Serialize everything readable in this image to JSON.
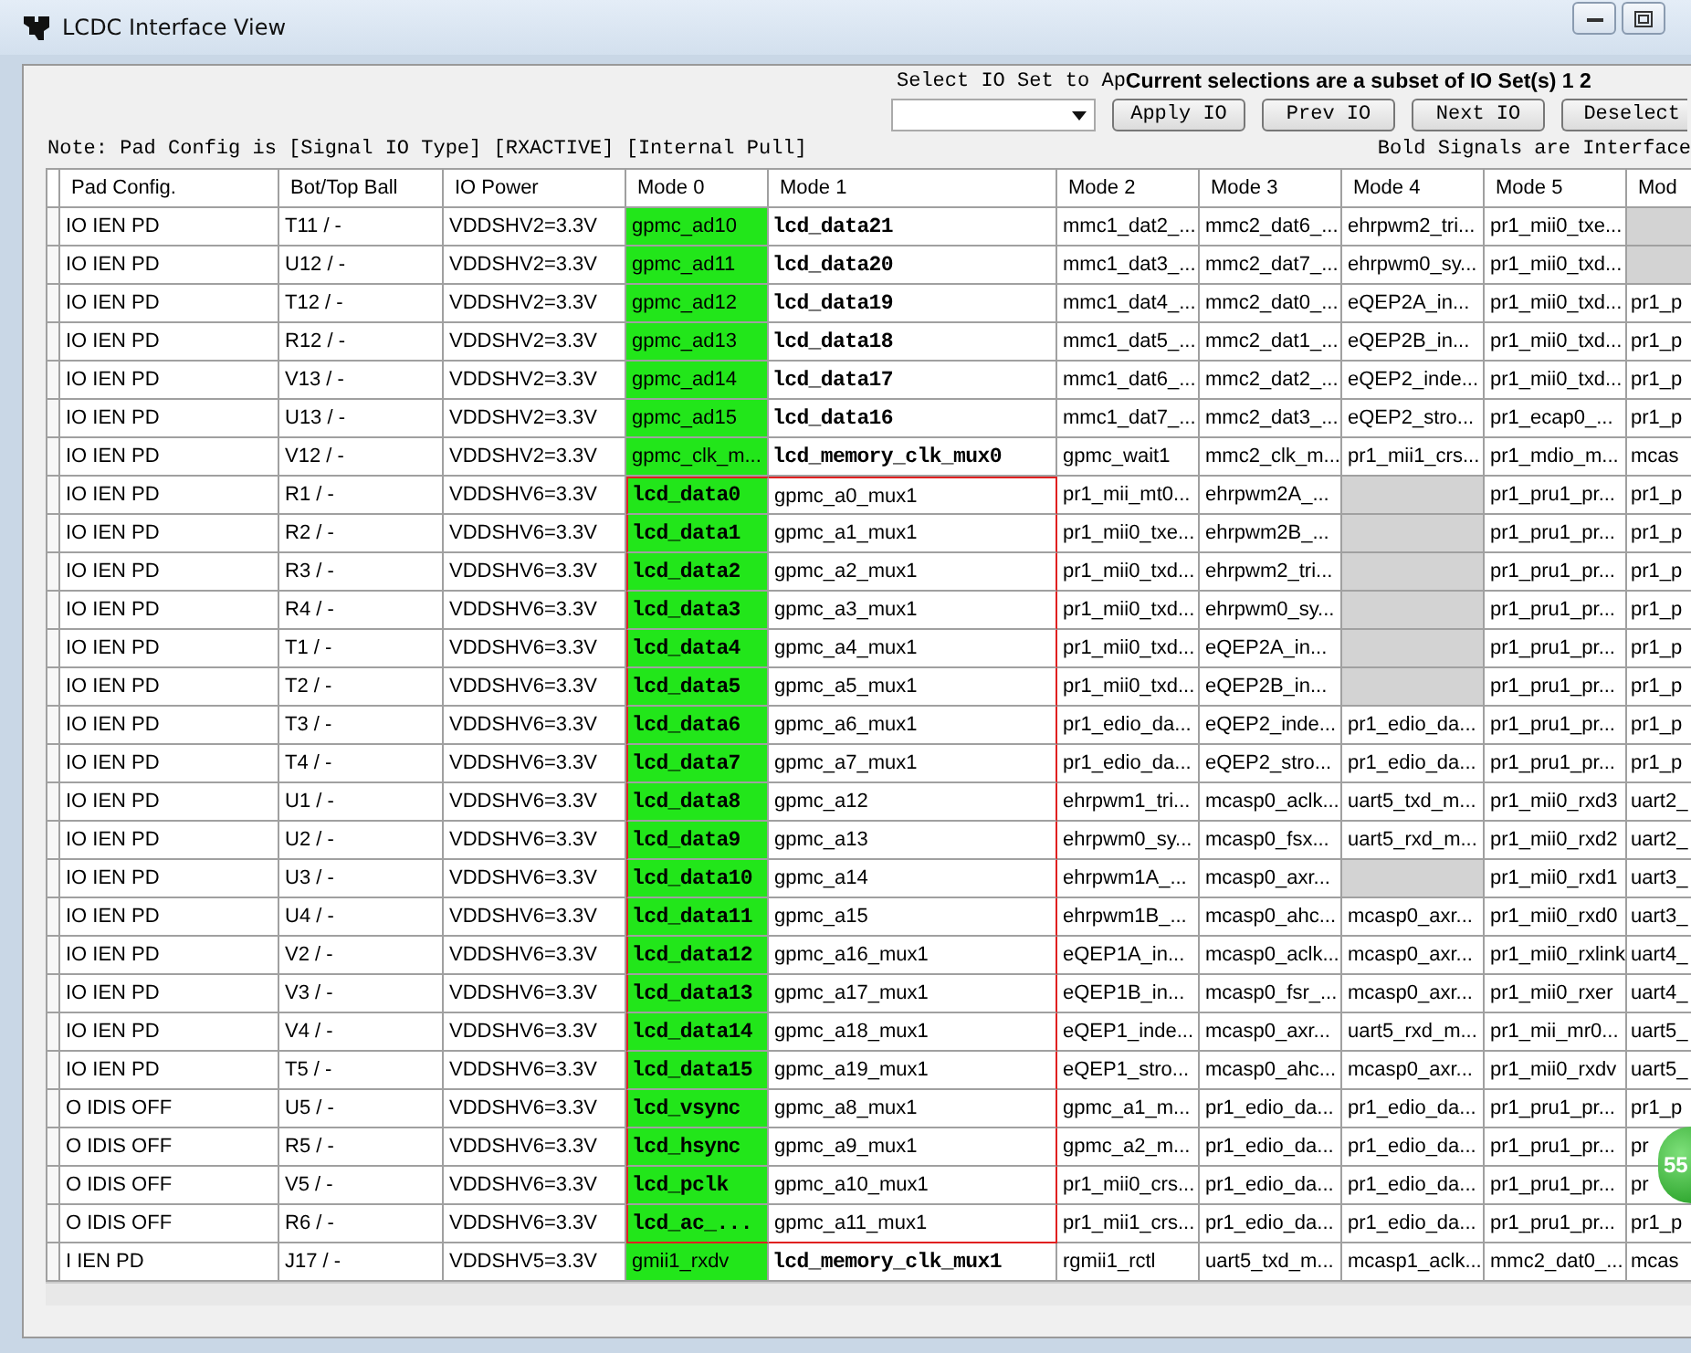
{
  "window": {
    "title": "LCDC Interface View"
  },
  "io_set": {
    "label": "Select IO Set to Ap",
    "status": "Current selections are a subset of IO Set(s)  1 2",
    "buttons": [
      "Apply IO",
      "Prev IO",
      "Next IO",
      "Deselect"
    ]
  },
  "note": "Note: Pad Config is [Signal IO Type] [RXACTIVE] [Internal Pull]",
  "legend": "Bold Signals are Interface",
  "table": {
    "columns": [
      "Pad Config.",
      "Bot/Top Ball",
      "IO Power",
      "Mode 0",
      "Mode 1",
      "Mode 2",
      "Mode 3",
      "Mode 4",
      "Mode 5",
      "Mod"
    ],
    "rows": [
      {
        "pad": "IO IEN PD",
        "ball": "T11 / -",
        "power": "VDDSHV2=3.3V",
        "outlined": false,
        "mode0": {
          "text": "gpmc_ad10",
          "bold": false,
          "selected": true
        },
        "mode1": {
          "text": "lcd_data21",
          "bold": true
        },
        "other_modes": [
          {
            "available": true,
            "text": "mmc1_dat2_..."
          },
          {
            "available": true,
            "text": "mmc2_dat6_..."
          },
          {
            "available": true,
            "text": "ehrpwm2_tri..."
          },
          {
            "available": true,
            "text": "pr1_mii0_txe..."
          },
          {
            "available": false
          }
        ]
      },
      {
        "pad": "IO IEN PD",
        "ball": "U12 / -",
        "power": "VDDSHV2=3.3V",
        "outlined": false,
        "mode0": {
          "text": "gpmc_ad11",
          "bold": false,
          "selected": true
        },
        "mode1": {
          "text": "lcd_data20",
          "bold": true
        },
        "other_modes": [
          {
            "available": true,
            "text": "mmc1_dat3_..."
          },
          {
            "available": true,
            "text": "mmc2_dat7_..."
          },
          {
            "available": true,
            "text": "ehrpwm0_sy..."
          },
          {
            "available": true,
            "text": "pr1_mii0_txd..."
          },
          {
            "available": false
          }
        ]
      },
      {
        "pad": "IO IEN PD",
        "ball": "T12 / -",
        "power": "VDDSHV2=3.3V",
        "outlined": false,
        "mode0": {
          "text": "gpmc_ad12",
          "bold": false,
          "selected": true
        },
        "mode1": {
          "text": "lcd_data19",
          "bold": true
        },
        "other_modes": [
          {
            "available": true,
            "text": "mmc1_dat4_..."
          },
          {
            "available": true,
            "text": "mmc2_dat0_..."
          },
          {
            "available": true,
            "text": "eQEP2A_in..."
          },
          {
            "available": true,
            "text": "pr1_mii0_txd..."
          },
          {
            "available": true,
            "text": "pr1_p"
          }
        ]
      },
      {
        "pad": "IO IEN PD",
        "ball": "R12 / -",
        "power": "VDDSHV2=3.3V",
        "outlined": false,
        "mode0": {
          "text": "gpmc_ad13",
          "bold": false,
          "selected": true
        },
        "mode1": {
          "text": "lcd_data18",
          "bold": true
        },
        "other_modes": [
          {
            "available": true,
            "text": "mmc1_dat5_..."
          },
          {
            "available": true,
            "text": "mmc2_dat1_..."
          },
          {
            "available": true,
            "text": "eQEP2B_in..."
          },
          {
            "available": true,
            "text": "pr1_mii0_txd..."
          },
          {
            "available": true,
            "text": "pr1_p"
          }
        ]
      },
      {
        "pad": "IO IEN PD",
        "ball": "V13 / -",
        "power": "VDDSHV2=3.3V",
        "outlined": false,
        "mode0": {
          "text": "gpmc_ad14",
          "bold": false,
          "selected": true
        },
        "mode1": {
          "text": "lcd_data17",
          "bold": true
        },
        "other_modes": [
          {
            "available": true,
            "text": "mmc1_dat6_..."
          },
          {
            "available": true,
            "text": "mmc2_dat2_..."
          },
          {
            "available": true,
            "text": "eQEP2_inde..."
          },
          {
            "available": true,
            "text": "pr1_mii0_txd..."
          },
          {
            "available": true,
            "text": "pr1_p"
          }
        ]
      },
      {
        "pad": "IO IEN PD",
        "ball": "U13 / -",
        "power": "VDDSHV2=3.3V",
        "outlined": false,
        "mode0": {
          "text": "gpmc_ad15",
          "bold": false,
          "selected": true
        },
        "mode1": {
          "text": "lcd_data16",
          "bold": true
        },
        "other_modes": [
          {
            "available": true,
            "text": "mmc1_dat7_..."
          },
          {
            "available": true,
            "text": "mmc2_dat3_..."
          },
          {
            "available": true,
            "text": "eQEP2_stro..."
          },
          {
            "available": true,
            "text": "pr1_ecap0_..."
          },
          {
            "available": true,
            "text": "pr1_p"
          }
        ]
      },
      {
        "pad": "IO IEN PD",
        "ball": "V12 / -",
        "power": "VDDSHV2=3.3V",
        "outlined": false,
        "mode0": {
          "text": "gpmc_clk_m...",
          "bold": false,
          "selected": true
        },
        "mode1": {
          "text": "lcd_memory_clk_mux0",
          "bold": true
        },
        "other_modes": [
          {
            "available": true,
            "text": "gpmc_wait1"
          },
          {
            "available": true,
            "text": "mmc2_clk_m..."
          },
          {
            "available": true,
            "text": "pr1_mii1_crs..."
          },
          {
            "available": true,
            "text": "pr1_mdio_m..."
          },
          {
            "available": true,
            "text": "mcas"
          }
        ]
      },
      {
        "pad": "IO IEN PD",
        "ball": "R1 / -",
        "power": "VDDSHV6=3.3V",
        "outlined": true,
        "mode0": {
          "text": "lcd_data0",
          "bold": true,
          "selected": true
        },
        "mode1": {
          "text": "gpmc_a0_mux1",
          "bold": false
        },
        "other_modes": [
          {
            "available": true,
            "text": "pr1_mii_mt0..."
          },
          {
            "available": true,
            "text": "ehrpwm2A_..."
          },
          {
            "available": false
          },
          {
            "available": true,
            "text": "pr1_pru1_pr..."
          },
          {
            "available": true,
            "text": "pr1_p"
          }
        ]
      },
      {
        "pad": "IO IEN PD",
        "ball": "R2 / -",
        "power": "VDDSHV6=3.3V",
        "outlined": true,
        "mode0": {
          "text": "lcd_data1",
          "bold": true,
          "selected": true
        },
        "mode1": {
          "text": "gpmc_a1_mux1",
          "bold": false
        },
        "other_modes": [
          {
            "available": true,
            "text": "pr1_mii0_txe..."
          },
          {
            "available": true,
            "text": "ehrpwm2B_..."
          },
          {
            "available": false
          },
          {
            "available": true,
            "text": "pr1_pru1_pr..."
          },
          {
            "available": true,
            "text": "pr1_p"
          }
        ]
      },
      {
        "pad": "IO IEN PD",
        "ball": "R3 / -",
        "power": "VDDSHV6=3.3V",
        "outlined": true,
        "mode0": {
          "text": "lcd_data2",
          "bold": true,
          "selected": true
        },
        "mode1": {
          "text": "gpmc_a2_mux1",
          "bold": false
        },
        "other_modes": [
          {
            "available": true,
            "text": "pr1_mii0_txd..."
          },
          {
            "available": true,
            "text": "ehrpwm2_tri..."
          },
          {
            "available": false
          },
          {
            "available": true,
            "text": "pr1_pru1_pr..."
          },
          {
            "available": true,
            "text": "pr1_p"
          }
        ]
      },
      {
        "pad": "IO IEN PD",
        "ball": "R4 / -",
        "power": "VDDSHV6=3.3V",
        "outlined": true,
        "mode0": {
          "text": "lcd_data3",
          "bold": true,
          "selected": true
        },
        "mode1": {
          "text": "gpmc_a3_mux1",
          "bold": false
        },
        "other_modes": [
          {
            "available": true,
            "text": "pr1_mii0_txd..."
          },
          {
            "available": true,
            "text": "ehrpwm0_sy..."
          },
          {
            "available": false
          },
          {
            "available": true,
            "text": "pr1_pru1_pr..."
          },
          {
            "available": true,
            "text": "pr1_p"
          }
        ]
      },
      {
        "pad": "IO IEN PD",
        "ball": "T1 / -",
        "power": "VDDSHV6=3.3V",
        "outlined": true,
        "mode0": {
          "text": "lcd_data4",
          "bold": true,
          "selected": true
        },
        "mode1": {
          "text": "gpmc_a4_mux1",
          "bold": false
        },
        "other_modes": [
          {
            "available": true,
            "text": "pr1_mii0_txd..."
          },
          {
            "available": true,
            "text": "eQEP2A_in..."
          },
          {
            "available": false
          },
          {
            "available": true,
            "text": "pr1_pru1_pr..."
          },
          {
            "available": true,
            "text": "pr1_p"
          }
        ]
      },
      {
        "pad": "IO IEN PD",
        "ball": "T2 / -",
        "power": "VDDSHV6=3.3V",
        "outlined": true,
        "mode0": {
          "text": "lcd_data5",
          "bold": true,
          "selected": true
        },
        "mode1": {
          "text": "gpmc_a5_mux1",
          "bold": false
        },
        "other_modes": [
          {
            "available": true,
            "text": "pr1_mii0_txd..."
          },
          {
            "available": true,
            "text": "eQEP2B_in..."
          },
          {
            "available": false
          },
          {
            "available": true,
            "text": "pr1_pru1_pr..."
          },
          {
            "available": true,
            "text": "pr1_p"
          }
        ]
      },
      {
        "pad": "IO IEN PD",
        "ball": "T3 / -",
        "power": "VDDSHV6=3.3V",
        "outlined": true,
        "mode0": {
          "text": "lcd_data6",
          "bold": true,
          "selected": true
        },
        "mode1": {
          "text": "gpmc_a6_mux1",
          "bold": false
        },
        "other_modes": [
          {
            "available": true,
            "text": "pr1_edio_da..."
          },
          {
            "available": true,
            "text": "eQEP2_inde..."
          },
          {
            "available": true,
            "text": "pr1_edio_da..."
          },
          {
            "available": true,
            "text": "pr1_pru1_pr..."
          },
          {
            "available": true,
            "text": "pr1_p"
          }
        ]
      },
      {
        "pad": "IO IEN PD",
        "ball": "T4 / -",
        "power": "VDDSHV6=3.3V",
        "outlined": true,
        "mode0": {
          "text": "lcd_data7",
          "bold": true,
          "selected": true
        },
        "mode1": {
          "text": "gpmc_a7_mux1",
          "bold": false
        },
        "other_modes": [
          {
            "available": true,
            "text": "pr1_edio_da..."
          },
          {
            "available": true,
            "text": "eQEP2_stro..."
          },
          {
            "available": true,
            "text": "pr1_edio_da..."
          },
          {
            "available": true,
            "text": "pr1_pru1_pr..."
          },
          {
            "available": true,
            "text": "pr1_p"
          }
        ]
      },
      {
        "pad": "IO IEN PD",
        "ball": "U1 / -",
        "power": "VDDSHV6=3.3V",
        "outlined": true,
        "mode0": {
          "text": "lcd_data8",
          "bold": true,
          "selected": true
        },
        "mode1": {
          "text": "gpmc_a12",
          "bold": false
        },
        "other_modes": [
          {
            "available": true,
            "text": "ehrpwm1_tri..."
          },
          {
            "available": true,
            "text": "mcasp0_aclk..."
          },
          {
            "available": true,
            "text": "uart5_txd_m..."
          },
          {
            "available": true,
            "text": "pr1_mii0_rxd3"
          },
          {
            "available": true,
            "text": "uart2_"
          }
        ]
      },
      {
        "pad": "IO IEN PD",
        "ball": "U2 / -",
        "power": "VDDSHV6=3.3V",
        "outlined": true,
        "mode0": {
          "text": "lcd_data9",
          "bold": true,
          "selected": true
        },
        "mode1": {
          "text": "gpmc_a13",
          "bold": false
        },
        "other_modes": [
          {
            "available": true,
            "text": "ehrpwm0_sy..."
          },
          {
            "available": true,
            "text": "mcasp0_fsx..."
          },
          {
            "available": true,
            "text": "uart5_rxd_m..."
          },
          {
            "available": true,
            "text": "pr1_mii0_rxd2"
          },
          {
            "available": true,
            "text": "uart2_"
          }
        ]
      },
      {
        "pad": "IO IEN PD",
        "ball": "U3 / -",
        "power": "VDDSHV6=3.3V",
        "outlined": true,
        "mode0": {
          "text": "lcd_data10",
          "bold": true,
          "selected": true
        },
        "mode1": {
          "text": "gpmc_a14",
          "bold": false
        },
        "other_modes": [
          {
            "available": true,
            "text": "ehrpwm1A_..."
          },
          {
            "available": true,
            "text": "mcasp0_axr..."
          },
          {
            "available": false
          },
          {
            "available": true,
            "text": "pr1_mii0_rxd1"
          },
          {
            "available": true,
            "text": "uart3_"
          }
        ]
      },
      {
        "pad": "IO IEN PD",
        "ball": "U4 / -",
        "power": "VDDSHV6=3.3V",
        "outlined": true,
        "mode0": {
          "text": "lcd_data11",
          "bold": true,
          "selected": true
        },
        "mode1": {
          "text": "gpmc_a15",
          "bold": false
        },
        "other_modes": [
          {
            "available": true,
            "text": "ehrpwm1B_..."
          },
          {
            "available": true,
            "text": "mcasp0_ahc..."
          },
          {
            "available": true,
            "text": "mcasp0_axr..."
          },
          {
            "available": true,
            "text": "pr1_mii0_rxd0"
          },
          {
            "available": true,
            "text": "uart3_"
          }
        ]
      },
      {
        "pad": "IO IEN PD",
        "ball": "V2 / -",
        "power": "VDDSHV6=3.3V",
        "outlined": true,
        "mode0": {
          "text": "lcd_data12",
          "bold": true,
          "selected": true
        },
        "mode1": {
          "text": "gpmc_a16_mux1",
          "bold": false
        },
        "other_modes": [
          {
            "available": true,
            "text": "eQEP1A_in..."
          },
          {
            "available": true,
            "text": "mcasp0_aclk..."
          },
          {
            "available": true,
            "text": "mcasp0_axr..."
          },
          {
            "available": true,
            "text": "pr1_mii0_rxlink"
          },
          {
            "available": true,
            "text": "uart4_"
          }
        ]
      },
      {
        "pad": "IO IEN PD",
        "ball": "V3 / -",
        "power": "VDDSHV6=3.3V",
        "outlined": true,
        "mode0": {
          "text": "lcd_data13",
          "bold": true,
          "selected": true
        },
        "mode1": {
          "text": "gpmc_a17_mux1",
          "bold": false
        },
        "other_modes": [
          {
            "available": true,
            "text": "eQEP1B_in..."
          },
          {
            "available": true,
            "text": "mcasp0_fsr_..."
          },
          {
            "available": true,
            "text": "mcasp0_axr..."
          },
          {
            "available": true,
            "text": "pr1_mii0_rxer"
          },
          {
            "available": true,
            "text": "uart4_"
          }
        ]
      },
      {
        "pad": "IO IEN PD",
        "ball": "V4 / -",
        "power": "VDDSHV6=3.3V",
        "outlined": true,
        "mode0": {
          "text": "lcd_data14",
          "bold": true,
          "selected": true
        },
        "mode1": {
          "text": "gpmc_a18_mux1",
          "bold": false
        },
        "other_modes": [
          {
            "available": true,
            "text": "eQEP1_inde..."
          },
          {
            "available": true,
            "text": "mcasp0_axr..."
          },
          {
            "available": true,
            "text": "uart5_rxd_m..."
          },
          {
            "available": true,
            "text": "pr1_mii_mr0..."
          },
          {
            "available": true,
            "text": "uart5_"
          }
        ]
      },
      {
        "pad": "IO IEN PD",
        "ball": "T5 / -",
        "power": "VDDSHV6=3.3V",
        "outlined": true,
        "mode0": {
          "text": "lcd_data15",
          "bold": true,
          "selected": true
        },
        "mode1": {
          "text": "gpmc_a19_mux1",
          "bold": false
        },
        "other_modes": [
          {
            "available": true,
            "text": "eQEP1_stro..."
          },
          {
            "available": true,
            "text": "mcasp0_ahc..."
          },
          {
            "available": true,
            "text": "mcasp0_axr..."
          },
          {
            "available": true,
            "text": "pr1_mii0_rxdv"
          },
          {
            "available": true,
            "text": "uart5_"
          }
        ]
      },
      {
        "pad": "O  IDIS OFF",
        "ball": "U5 / -",
        "power": "VDDSHV6=3.3V",
        "outlined": true,
        "mode0": {
          "text": "lcd_vsync",
          "bold": true,
          "selected": true
        },
        "mode1": {
          "text": "gpmc_a8_mux1",
          "bold": false
        },
        "other_modes": [
          {
            "available": true,
            "text": "gpmc_a1_m..."
          },
          {
            "available": true,
            "text": "pr1_edio_da..."
          },
          {
            "available": true,
            "text": "pr1_edio_da..."
          },
          {
            "available": true,
            "text": "pr1_pru1_pr..."
          },
          {
            "available": true,
            "text": "pr1_p"
          }
        ]
      },
      {
        "pad": "O  IDIS OFF",
        "ball": "R5 / -",
        "power": "VDDSHV6=3.3V",
        "outlined": true,
        "mode0": {
          "text": "lcd_hsync",
          "bold": true,
          "selected": true
        },
        "mode1": {
          "text": "gpmc_a9_mux1",
          "bold": false
        },
        "other_modes": [
          {
            "available": true,
            "text": "gpmc_a2_m..."
          },
          {
            "available": true,
            "text": "pr1_edio_da..."
          },
          {
            "available": true,
            "text": "pr1_edio_da..."
          },
          {
            "available": true,
            "text": "pr1_pru1_pr..."
          },
          {
            "available": true,
            "text": "pr"
          }
        ]
      },
      {
        "pad": "O  IDIS OFF",
        "ball": "V5 / -",
        "power": "VDDSHV6=3.3V",
        "outlined": true,
        "mode0": {
          "text": "lcd_pclk",
          "bold": true,
          "selected": true
        },
        "mode1": {
          "text": "gpmc_a10_mux1",
          "bold": false
        },
        "other_modes": [
          {
            "available": true,
            "text": "pr1_mii0_crs..."
          },
          {
            "available": true,
            "text": "pr1_edio_da..."
          },
          {
            "available": true,
            "text": "pr1_edio_da..."
          },
          {
            "available": true,
            "text": "pr1_pru1_pr..."
          },
          {
            "available": true,
            "text": "pr"
          }
        ]
      },
      {
        "pad": "O  IDIS OFF",
        "ball": "R6 / -",
        "power": "VDDSHV6=3.3V",
        "outlined": true,
        "mode0": {
          "text": "lcd_ac_...",
          "bold": true,
          "selected": true
        },
        "mode1": {
          "text": "gpmc_a11_mux1",
          "bold": false
        },
        "other_modes": [
          {
            "available": true,
            "text": "pr1_mii1_crs..."
          },
          {
            "available": true,
            "text": "pr1_edio_da..."
          },
          {
            "available": true,
            "text": "pr1_edio_da..."
          },
          {
            "available": true,
            "text": "pr1_pru1_pr..."
          },
          {
            "available": true,
            "text": "pr1_p"
          }
        ]
      },
      {
        "pad": "I  IEN PD",
        "ball": "J17 / -",
        "power": "VDDSHV5=3.3V",
        "outlined": false,
        "mode0": {
          "text": "gmii1_rxdv",
          "bold": false,
          "selected": true
        },
        "mode1": {
          "text": "lcd_memory_clk_mux1",
          "bold": true
        },
        "other_modes": [
          {
            "available": true,
            "text": "rgmii1_rctl"
          },
          {
            "available": true,
            "text": "uart5_txd_m..."
          },
          {
            "available": true,
            "text": "mcasp1_aclk..."
          },
          {
            "available": true,
            "text": "mmc2_dat0_..."
          },
          {
            "available": true,
            "text": "mcas"
          }
        ]
      }
    ]
  },
  "badge": "55"
}
